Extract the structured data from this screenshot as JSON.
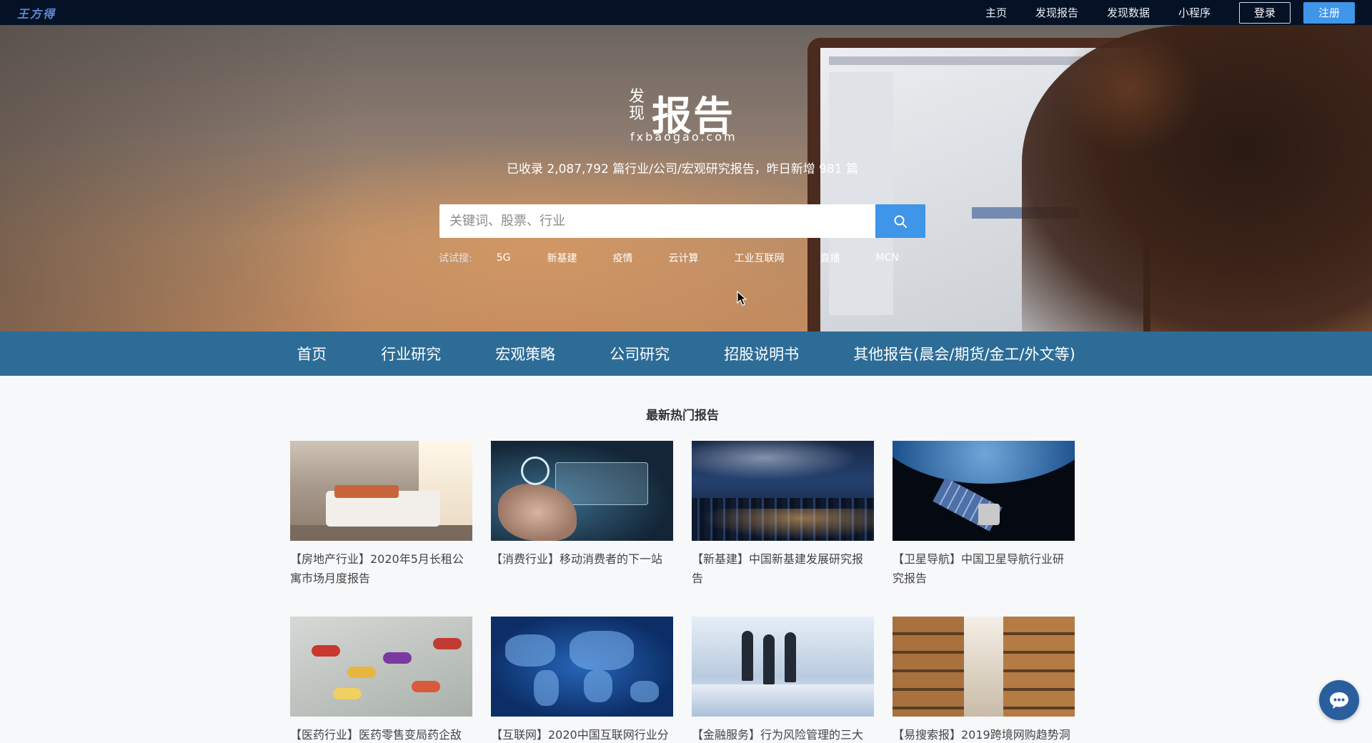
{
  "topbar": {
    "brand": "王方得",
    "nav": [
      "主页",
      "发现报告",
      "发现数据",
      "小程序"
    ],
    "login_label": "登录",
    "register_label": "注册"
  },
  "hero": {
    "logo_small": "发现",
    "logo_big": "报告",
    "logo_domain": "fxbaogao.com",
    "tagline": "已收录 2,087,792 篇行业/公司/宏观研究报告，昨日新增 981 篇",
    "search": {
      "placeholder": "关键词、股票、行业",
      "value": ""
    },
    "suggest_label": "试试搜:",
    "suggest_items": [
      "5G",
      "新基建",
      "疫情",
      "云计算",
      "工业互联网",
      "直播",
      "MCN"
    ]
  },
  "category_nav": [
    "首页",
    "行业研究",
    "宏观策略",
    "公司研究",
    "招股说明书",
    "其他报告(晨会/期货/金工/外文等)"
  ],
  "section": {
    "title": "最新热门报告",
    "cards": [
      {
        "title": "【房地产行业】2020年5月长租公寓市场月度报告",
        "image": "bedroom-photo"
      },
      {
        "title": "【消费行业】移动消费者的下一站",
        "image": "mobile-pay-photo"
      },
      {
        "title": "【新基建】中国新基建发展研究报告",
        "image": "city-network-photo"
      },
      {
        "title": "【卫星导航】中国卫星导航行业研究报告",
        "image": "satellite-photo"
      },
      {
        "title": "【医药行业】医药零售变局药企敌",
        "image": "pills-money-photo"
      },
      {
        "title": "【互联网】2020中国互联网行业分",
        "image": "world-map-photo"
      },
      {
        "title": "【金融服务】行为风险管理的三大",
        "image": "business-meeting-photo"
      },
      {
        "title": "【易搜索报】2019跨境网购趋势洞",
        "image": "warehouse-photo"
      }
    ]
  },
  "colors": {
    "topbar_bg": "#051226",
    "accent": "#3f95e8",
    "category_bar_bg": "#2e6c98"
  }
}
